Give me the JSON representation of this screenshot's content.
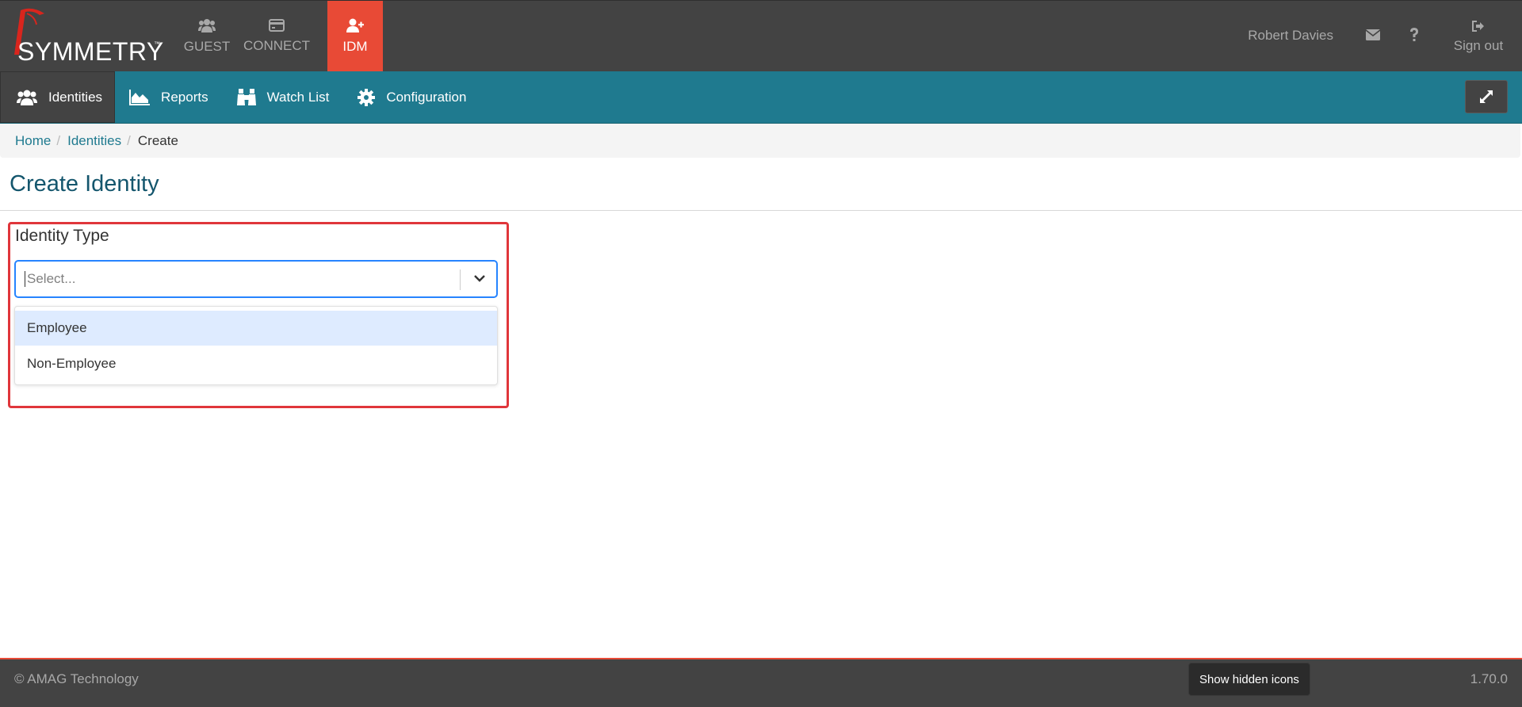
{
  "header": {
    "logo_text": "SYMMETRY",
    "logo_tm": "™",
    "apps": [
      {
        "label": "GUEST",
        "icon": "users-icon"
      },
      {
        "label": "CONNECT",
        "icon": "card-icon"
      },
      {
        "label": "IDM",
        "icon": "user-plus-icon"
      }
    ],
    "user_name": "Robert Davies",
    "signout_label": "Sign out"
  },
  "subnav": {
    "items": [
      {
        "label": "Identities",
        "icon": "users-icon"
      },
      {
        "label": "Reports",
        "icon": "area-chart-icon"
      },
      {
        "label": "Watch List",
        "icon": "binoculars-icon"
      },
      {
        "label": "Configuration",
        "icon": "gear-icon"
      }
    ]
  },
  "breadcrumb": {
    "items": [
      "Home",
      "Identities"
    ],
    "current": "Create",
    "separator": "/"
  },
  "page": {
    "title": "Create Identity"
  },
  "form": {
    "identity_type_label": "Identity Type",
    "select_placeholder": "Select...",
    "options": [
      "Employee",
      "Non-Employee"
    ]
  },
  "footer": {
    "copyright": "© AMAG Technology",
    "version": "1.70.0"
  },
  "tooltip": {
    "text": "Show hidden icons"
  },
  "colors": {
    "header_bg": "#434343",
    "accent_red": "#e84a36",
    "subnav_teal": "#1f7a8f",
    "title_blue": "#14566d",
    "highlight_red": "#e0363b",
    "focus_blue": "#2684ff",
    "option_focus": "#deebff"
  }
}
